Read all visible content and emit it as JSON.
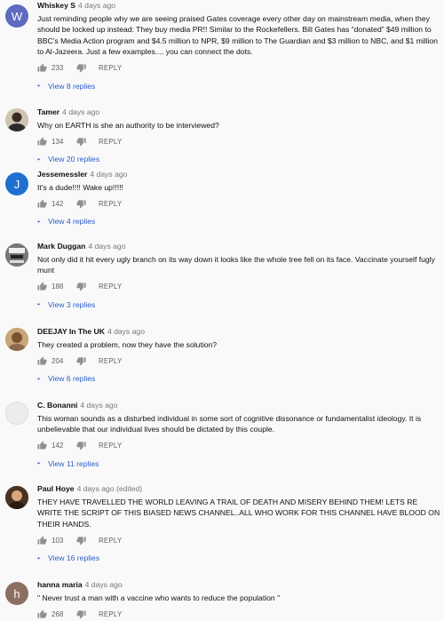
{
  "comments": [
    {
      "author": "Whiskey S",
      "date": "4 days ago",
      "avatar_letter": "W",
      "avatar_color": "#5c6bc0",
      "text": "Just reminding people why we are seeing praised Gates coverage every other day on mainstream media, when they should be locked up instead: They buy media PR!! Similar to the Rockefellers. Bill Gates has “donated” $49 million to BBC’s Media Action program and $4.5 million to NPR, $9 million to The Guardian and $3 million to NBC, and $1 million to Al-Jazeera. Just a few examples.... you can connect the dots.",
      "likes": "233",
      "reply_label": "REPLY",
      "view_replies": "View 8 replies"
    },
    {
      "author": "Tamer",
      "date": "4 days ago",
      "avatar_letter": "",
      "avatar_color": "#c9b8a4",
      "text": "Why on EARTH is she an authority to be interviewed?",
      "likes": "134",
      "reply_label": "REPLY",
      "view_replies": "View 20 replies"
    },
    {
      "author": "Jessemessler",
      "date": "4 days ago",
      "avatar_letter": "J",
      "avatar_color": "#1e6fd0",
      "text": "It's a dude!!!! Wake up!!!!!",
      "likes": "142",
      "reply_label": "REPLY",
      "view_replies": "View 4 replies"
    },
    {
      "author": "Mark Duggan",
      "date": "4 days ago",
      "avatar_letter": "",
      "avatar_color": "#6e6e6e",
      "text": "Not only did it hit every ugly branch on its way down it looks like the whole tree fell on its face. Vaccinate yourself fugly munt",
      "likes": "188",
      "reply_label": "REPLY",
      "view_replies": "View 3 replies"
    },
    {
      "author": "DEEJAY In The UK",
      "date": "4 days ago",
      "avatar_letter": "",
      "avatar_color": "#b8956a",
      "text": "They created a problem, now they have the solution?",
      "likes": "204",
      "reply_label": "REPLY",
      "view_replies": "View 6 replies"
    },
    {
      "author": "C. Bonanni",
      "date": "4 days ago",
      "avatar_letter": "",
      "avatar_color": "#e6e6e6",
      "text": "This woman sounds as a disturbed individual in some sort of cognitive dissonance or fundamentalist ideology. It is unbelievable that our individual lives should be dictated by this couple.",
      "likes": "142",
      "reply_label": "REPLY",
      "view_replies": "View 11 replies"
    },
    {
      "author": "Paul Hoye",
      "date": "4 days ago (edited)",
      "avatar_letter": "",
      "avatar_color": "#5a3d2b",
      "text": "THEY HAVE TRAVELLED THE WORLD LEAVING A TRAIL OF DEATH AND MISERY BEHIND THEM!  LETS RE WRITE THE SCRIPT OF THIS BIASED NEWS CHANNEL..ALL WHO WORK FOR THIS CHANNEL  HAVE BLOOD ON THEIR HANDS.",
      "likes": "103",
      "reply_label": "REPLY",
      "view_replies": "View 16 replies"
    },
    {
      "author": "hanna maria",
      "date": "4 days ago",
      "avatar_letter": "h",
      "avatar_color": "#8d6e63",
      "text": "\" Never trust a man with a vaccine who wants to reduce the population \"",
      "likes": "268",
      "reply_label": "REPLY",
      "view_replies": ""
    }
  ]
}
